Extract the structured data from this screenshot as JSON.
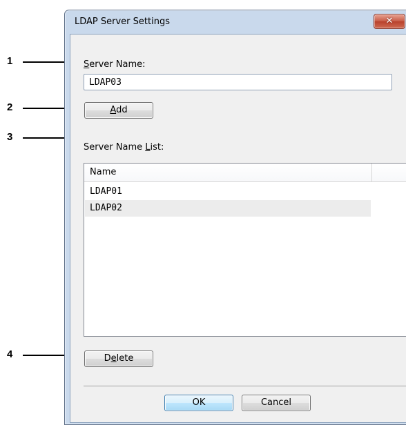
{
  "callouts": [
    "1",
    "2",
    "3",
    "4"
  ],
  "window": {
    "title": "LDAP Server Settings",
    "close_label": "✕"
  },
  "server_name": {
    "label_accel": "S",
    "label_rest": "erver Name:",
    "value": "LDAP03"
  },
  "add_button": {
    "accel": "A",
    "rest": "dd"
  },
  "server_list": {
    "label_before": "Server Name ",
    "label_accel": "L",
    "label_after": "ist:",
    "column_header": "Name",
    "rows": [
      "LDAP01",
      "LDAP02"
    ]
  },
  "delete_button": {
    "before": "D",
    "accel": "e",
    "after": "lete"
  },
  "ok_label": "OK",
  "cancel_label": "Cancel",
  "colors": {
    "title_bar": "#c9d9ec",
    "dialog_body": "#f0f0f0",
    "close_button": "#c75a45",
    "ok_button_border": "#3c7fb1"
  }
}
